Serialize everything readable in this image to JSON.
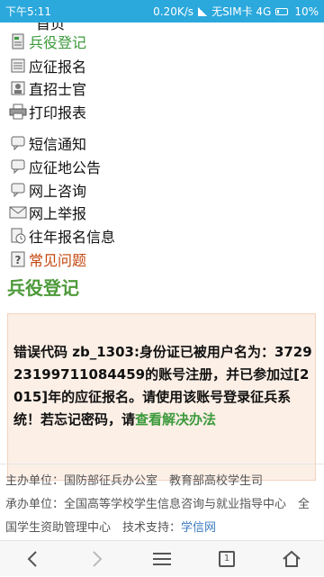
{
  "status_bar": {
    "time": "下午5:11",
    "speed": "0.20K/s",
    "carrier": "无SIM卡 4G",
    "battery": "10%"
  },
  "menu": {
    "clipped_top": "首页",
    "items": [
      {
        "label": "兵役登记",
        "icon": "doc-icon",
        "style": "green"
      },
      {
        "label": "应征报名",
        "icon": "form-icon",
        "style": "normal"
      },
      {
        "label": "直招士官",
        "icon": "person-card-icon",
        "style": "normal"
      },
      {
        "label": "打印报表",
        "icon": "printer-icon",
        "style": "normal"
      },
      {
        "label": "短信通知",
        "icon": "chat-icon",
        "style": "normal"
      },
      {
        "label": "应征地公告",
        "icon": "chat-icon",
        "style": "normal"
      },
      {
        "label": "网上咨询",
        "icon": "chat-icon",
        "style": "normal"
      },
      {
        "label": "网上举报",
        "icon": "mail-icon",
        "style": "normal"
      },
      {
        "label": "往年报名信息",
        "icon": "history-icon",
        "style": "normal"
      },
      {
        "label": "常见问题",
        "icon": "question-icon",
        "style": "red"
      }
    ]
  },
  "section_title": "兵役登记",
  "alert": {
    "text": "错误代码 zb_1303:身份证已被用户名为：372923199711084459的账号注册，并已参加过[2015]年的应征报名。请使用该账号登录征兵系统！若忘记密码，请",
    "link": "查看解决办法"
  },
  "footer": {
    "line1": "主办单位：国防部征兵办公室　教育部高校学生司",
    "line2": "承办单位：全国高等学校学生信息咨询与就业指导中心　全国学生资助管理中心　技术支持：",
    "support_link": "学信网"
  },
  "navbar": {
    "tab_count": "1"
  }
}
